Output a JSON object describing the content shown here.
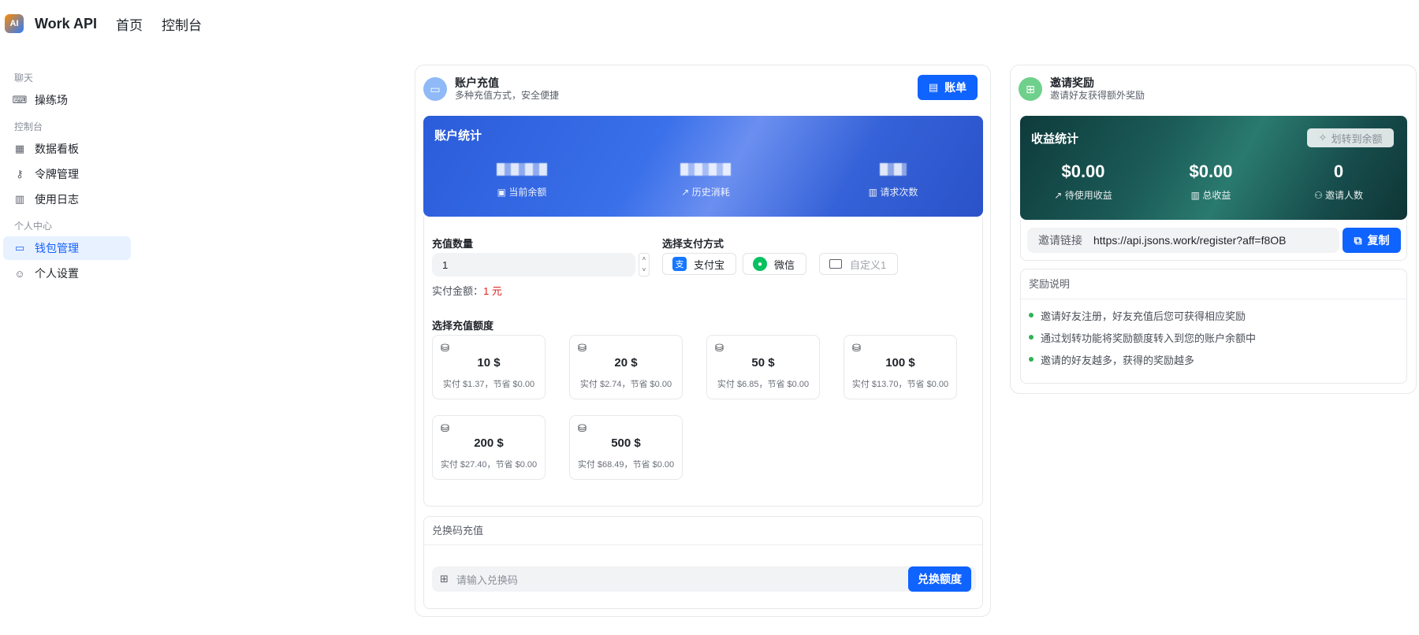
{
  "header": {
    "logo_text": "AI",
    "brand": "Work API",
    "nav": [
      "首页",
      "控制台"
    ]
  },
  "sidebar": {
    "groups": [
      {
        "label": "聊天",
        "items": [
          {
            "label": "操练场",
            "icon": "terminal-icon"
          }
        ]
      },
      {
        "label": "控制台",
        "items": [
          {
            "label": "数据看板",
            "icon": "grid-icon"
          },
          {
            "label": "令牌管理",
            "icon": "key-icon"
          },
          {
            "label": "使用日志",
            "icon": "chart-bar-icon"
          }
        ]
      },
      {
        "label": "个人中心",
        "items": [
          {
            "label": "钱包管理",
            "icon": "wallet-icon",
            "active": true
          },
          {
            "label": "个人设置",
            "icon": "user-icon"
          }
        ]
      }
    ]
  },
  "recharge": {
    "title": "账户充值",
    "subtitle": "多种充值方式，安全便捷",
    "bill_button": "账单",
    "stats": {
      "title": "账户统计",
      "items": [
        {
          "label": "当前余额",
          "icon": "wallet-icon"
        },
        {
          "label": "历史消耗",
          "icon": "trend-up-icon"
        },
        {
          "label": "请求次数",
          "icon": "chart-bar-icon"
        }
      ]
    },
    "quantity_label": "充值数量",
    "quantity_value": "1",
    "pay_label": "实付金额：",
    "pay_amount": "1 元",
    "method_label": "选择支付方式",
    "methods": [
      {
        "label": "支付宝",
        "icon": "alipay-icon"
      },
      {
        "label": "微信",
        "icon": "wechat-icon"
      },
      {
        "label": "自定义1",
        "icon": "card-icon",
        "disabled": true
      }
    ],
    "amount_label": "选择充值额度",
    "amounts": [
      {
        "value": "10 $",
        "desc": "实付 $1.37，节省 $0.00"
      },
      {
        "value": "20 $",
        "desc": "实付 $2.74，节省 $0.00"
      },
      {
        "value": "50 $",
        "desc": "实付 $6.85，节省 $0.00"
      },
      {
        "value": "100 $",
        "desc": "实付 $13.70，节省 $0.00"
      },
      {
        "value": "200 $",
        "desc": "实付 $27.40，节省 $0.00"
      },
      {
        "value": "500 $",
        "desc": "实付 $68.49，节省 $0.00"
      }
    ],
    "redeem": {
      "title": "兑换码充值",
      "placeholder": "请输入兑换码",
      "button": "兑换额度"
    }
  },
  "invite": {
    "title": "邀请奖励",
    "subtitle": "邀请好友获得额外奖励",
    "stats": {
      "title": "收益统计",
      "transfer_button": "划转到余额",
      "items": [
        {
          "value": "$0.00",
          "label": "待使用收益",
          "icon": "trend-up-icon"
        },
        {
          "value": "$0.00",
          "label": "总收益",
          "icon": "chart-bar-icon"
        },
        {
          "value": "0",
          "label": "邀请人数",
          "icon": "users-icon"
        }
      ]
    },
    "link_label": "邀请链接",
    "link_value": "https://api.jsons.work/register?aff=f8OB",
    "copy_button": "复制",
    "rules": {
      "title": "奖励说明",
      "items": [
        "邀请好友注册，好友充值后您可获得相应奖励",
        "通过划转功能将奖励额度转入到您的账户余额中",
        "邀请的好友越多，获得的奖励越多"
      ]
    }
  },
  "colors": {
    "primary": "#0f63ff",
    "price": "#e02020",
    "active_bg": "#e8f1ff",
    "bullet": "#31b057"
  }
}
